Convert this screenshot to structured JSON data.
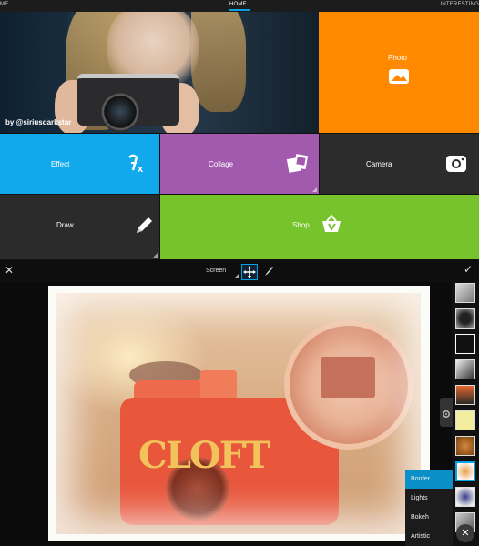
{
  "topnav": {
    "left_label": "ME",
    "home_label": "HOME",
    "right_label": "INTERESTING"
  },
  "hero": {
    "credit": "by @siriusdarkstar"
  },
  "tiles": {
    "photo": "Photo",
    "effect": "Effect",
    "collage": "Collage",
    "camera": "Camera",
    "draw": "Draw",
    "shop": "Shop"
  },
  "editor": {
    "blend_mode": "Screen"
  },
  "categories": {
    "border": "Border",
    "lights": "Lights",
    "bokeh": "Bokeh",
    "artistic": "Artistic"
  },
  "photo_text": "CLOFT",
  "colors": {
    "accent": "#00a4e4",
    "photo_tile": "#ff8a00",
    "effect_tile": "#12a9ec",
    "collage_tile": "#a15aad",
    "shop_tile": "#77c32b",
    "dark_tile": "#2b2b2b"
  },
  "icons": {
    "photo": "gallery-icon",
    "effect": "fx-icon",
    "collage": "collage-icon",
    "camera": "camera-icon",
    "draw": "pencil-icon",
    "shop": "basket-icon",
    "close": "close-icon",
    "move": "move-icon",
    "brush": "brush-icon",
    "confirm": "check-icon",
    "settings": "gear-icon"
  }
}
